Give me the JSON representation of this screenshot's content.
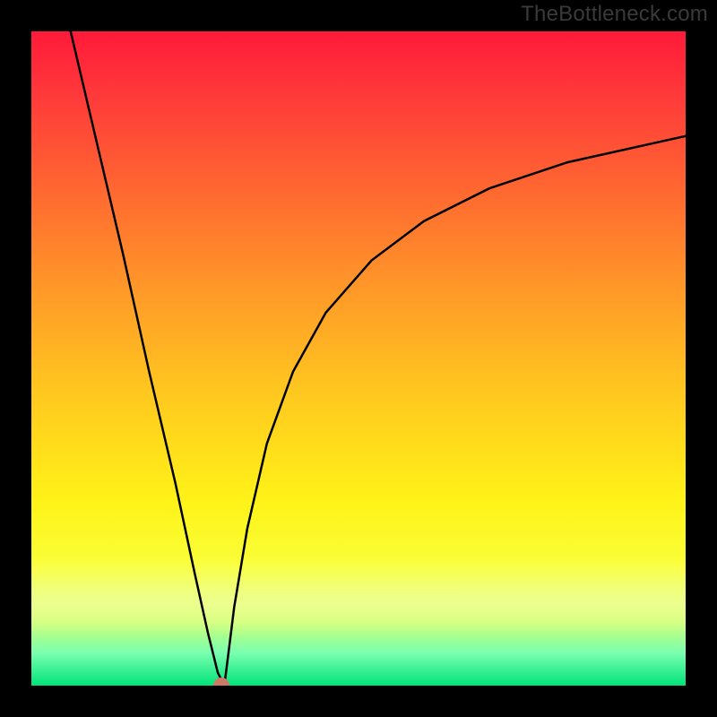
{
  "watermark": "TheBottleneck.com",
  "colors": {
    "marker": "#cc7a66",
    "curve": "#000000"
  },
  "chart_data": {
    "type": "line",
    "title": "",
    "xlabel": "",
    "ylabel": "",
    "xlim": [
      0,
      100
    ],
    "ylim": [
      0,
      100
    ],
    "grid": false,
    "legend": false,
    "background": "red-yellow-green vertical gradient",
    "minimum_marker": {
      "x": 29,
      "y": 0,
      "color": "#cc7a66"
    },
    "series": [
      {
        "name": "left-branch",
        "x": [
          6,
          10,
          14,
          18,
          22,
          25,
          27,
          28.5,
          29.5
        ],
        "y": [
          100,
          83,
          66,
          48,
          31,
          17,
          8,
          2,
          0
        ]
      },
      {
        "name": "right-branch",
        "x": [
          29.5,
          30,
          31,
          33,
          36,
          40,
          45,
          52,
          60,
          70,
          82,
          100
        ],
        "y": [
          0,
          4,
          12,
          24,
          37,
          48,
          57,
          65,
          71,
          76,
          80,
          84
        ]
      }
    ]
  }
}
